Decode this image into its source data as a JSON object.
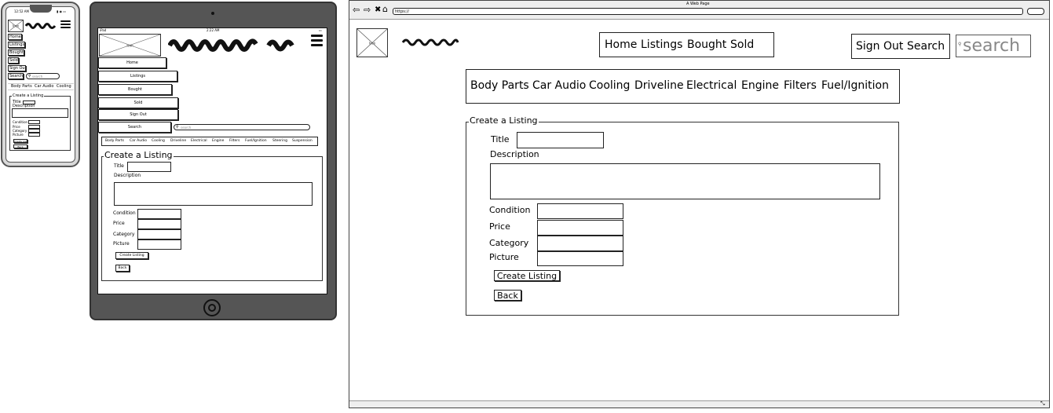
{
  "colors": {
    "ink": "#222222",
    "device": "#555555",
    "device_light": "#e0e0e0",
    "placeholder": "#888888"
  },
  "icons": {
    "image_placeholder": "x-image-placeholder-icon",
    "menu": "hamburger-icon",
    "back": "arrow-left-icon",
    "forward": "arrow-right-icon",
    "stop": "x-close-icon",
    "home": "home-icon",
    "search": "magnifier-icon",
    "home_button": "circle-home-button-icon"
  },
  "phone": {
    "status_time": "12:52 AM",
    "logo_text": "Icon",
    "nav": [
      "Home",
      "Listings",
      "Bought",
      "Sold",
      "Sign Out"
    ],
    "search_button": "Search",
    "search_placeholder": "search",
    "categories": [
      "Body Parts",
      "Car Audio",
      "Cooling"
    ],
    "form": {
      "legend": "Create a Listing",
      "title": "Title",
      "description": "Description",
      "condition": "Condition",
      "price": "Price",
      "category": "Category",
      "picture": "Picture",
      "create_button": "Create Listing",
      "back_button": "Back"
    }
  },
  "tablet": {
    "status_left": "iPad",
    "status_time": "2:22 AM",
    "logo_text": "Icon",
    "nav": [
      "Home",
      "Listings",
      "Bought",
      "Sold",
      "Sign Out"
    ],
    "search_button": "Search",
    "search_placeholder": "search",
    "categories": [
      "Body Parts",
      "Car Audio",
      "Cooling",
      "Driveline",
      "Electrical",
      "Engine",
      "Filters",
      "Fuel/Ignition",
      "Steering",
      "Suspension"
    ],
    "form": {
      "legend": "Create a Listing",
      "title": "Title",
      "description": "Description",
      "condition": "Condition",
      "price": "Price",
      "category": "Category",
      "picture": "Picture",
      "create_button": "Create Listing",
      "back_button": "Back"
    }
  },
  "desktop": {
    "window_title": "A Web Page",
    "url": "https://",
    "logo_text": "Icon",
    "nav": [
      "Home",
      "Listings",
      "Bought",
      "Sold"
    ],
    "sign_out": "Sign Out",
    "search_button": "Search",
    "search_placeholder": "search",
    "categories": [
      "Body Parts",
      "Car Audio",
      "Cooling",
      "Driveline",
      "Electrical",
      "Engine",
      "Filters",
      "Fuel/Ignition"
    ],
    "form": {
      "legend": "Create a Listing",
      "title": "Title",
      "description": "Description",
      "condition": "Condition",
      "price": "Price",
      "category": "Category",
      "picture": "Picture",
      "create_button": "Create Listing",
      "back_button": "Back"
    }
  }
}
